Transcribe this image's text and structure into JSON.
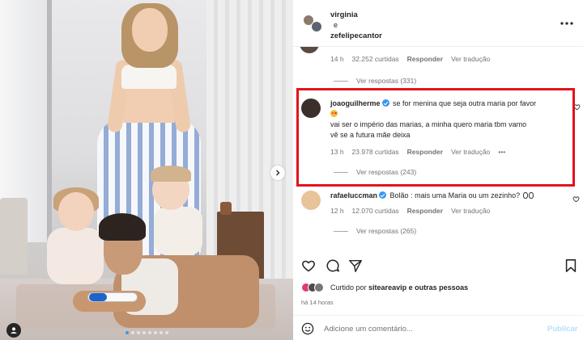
{
  "post": {
    "authors": {
      "primary": "virginia",
      "connector": "e",
      "secondary": "zefelipecantor"
    },
    "carousel": {
      "slide_count": 8,
      "active_slide": 1
    }
  },
  "comments": [
    {
      "username": "",
      "text": "",
      "time": "14 h",
      "likes": "32.252 curtidas",
      "reply_label": "Responder",
      "translate_label": "Ver tradução",
      "replies_label": "Ver respostas (331)"
    },
    {
      "username": "joaoguilherme",
      "verified": true,
      "text_line1": "se for menina que seja outra maria por favor",
      "text_emoji": "heart-eyes-emoji",
      "text_line2": "vai ser o império das marias, a minha quero maria tbm vamo",
      "text_line3": "vê se a futura mãe deixa",
      "time": "13 h",
      "likes": "23.978 curtidas",
      "reply_label": "Responder",
      "translate_label": "Ver tradução",
      "more_label": "•••",
      "replies_label": "Ver respostas (243)",
      "highlight_color": "#e3131b"
    },
    {
      "username": "rafaeluccman",
      "verified": true,
      "text": "Bolão : mais uma Maria ou um zezinho?",
      "text_emoji": "eyes-emoji",
      "time": "12 h",
      "likes": "12.070 curtidas",
      "reply_label": "Responder",
      "translate_label": "Ver tradução",
      "replies_label": "Ver respostas (265)"
    }
  ],
  "actions": {
    "icons": [
      "heart-icon",
      "comment-icon",
      "share-icon",
      "bookmark-icon"
    ]
  },
  "liked_by": {
    "prefix": "Curtido por",
    "user": "siteareavip",
    "suffix": "e outras pessoas"
  },
  "timestamp": "há 14 horas",
  "composer": {
    "placeholder": "Adicione um comentário...",
    "publish_label": "Publicar"
  },
  "colors": {
    "accent_blue": "#3897f0",
    "publish_disabled": "#b2dffc",
    "highlight_red": "#e3131b",
    "secondary_text": "#737373"
  }
}
